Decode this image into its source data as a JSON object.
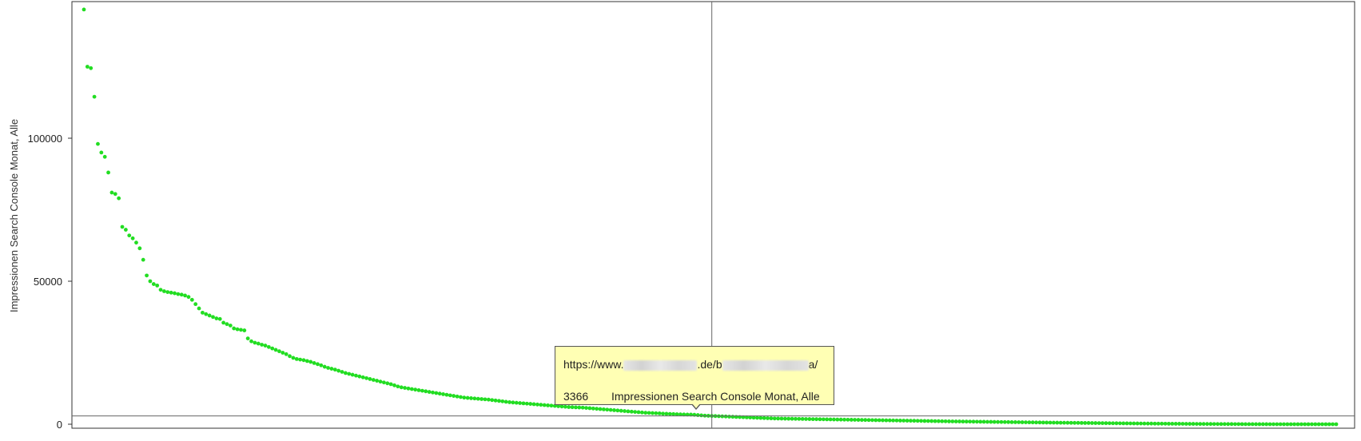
{
  "chart_data": {
    "type": "scatter",
    "title": "",
    "xlabel": "",
    "ylabel": "Impressionen Search Console Monat, Alle",
    "ylim": [
      0,
      145000
    ],
    "yticks": [
      0,
      50000,
      100000
    ],
    "ytick_labels": [
      "0",
      "50000",
      "100000"
    ],
    "grid": false,
    "legend": "none",
    "point_color": "#22dd22",
    "crosshair_color": "#666666",
    "n_points": 380,
    "series": [
      {
        "values": [
          145000,
          125000,
          124500,
          114500,
          98000,
          95000,
          93500,
          88000,
          81000,
          80500,
          79000,
          69000,
          68000,
          66000,
          65000,
          63500,
          61500,
          57500,
          52000,
          50000,
          49000,
          48500,
          47000,
          46500,
          46200,
          46000,
          45800,
          45500,
          45300,
          45000,
          44500,
          43500,
          42000,
          40500,
          39000,
          38500,
          38000,
          37500,
          37000,
          36800,
          35500,
          35000,
          34500,
          33500,
          33200,
          33000,
          32800,
          30000,
          29000,
          28500,
          28200,
          27800,
          27500,
          27000,
          26500,
          26000,
          25500,
          25000,
          24500,
          23800,
          23200,
          22800,
          22600,
          22400,
          22100,
          21800,
          21400,
          21000,
          20600,
          20100,
          19700,
          19400,
          19100,
          18700,
          18300,
          17900,
          17600,
          17300,
          17000,
          16700,
          16400,
          16100,
          15800,
          15500,
          15200,
          14900,
          14600,
          14300,
          14000,
          13600,
          13200,
          12900,
          12700,
          12500,
          12300,
          12100,
          11900,
          11700,
          11500,
          11300,
          11100,
          10900,
          10700,
          10500,
          10300,
          10100,
          9900,
          9700,
          9500,
          9300,
          9200,
          9100,
          9000,
          8900,
          8800,
          8700,
          8600,
          8450,
          8300,
          8150,
          8000,
          7850,
          7700,
          7600,
          7500,
          7400,
          7300,
          7200,
          7100,
          7000,
          6900,
          6800,
          6700,
          6600,
          6500,
          6400,
          6300,
          6200,
          6100,
          6000,
          5950,
          5900,
          5850,
          5800,
          5700,
          5600,
          5500,
          5400,
          5300,
          5200,
          5100,
          5000,
          4900,
          4800,
          4700,
          4600,
          4500,
          4400,
          4300,
          4200,
          4100,
          4000,
          3950,
          3900,
          3850,
          3800,
          3700,
          3650,
          3600,
          3550,
          3500,
          3450,
          3400,
          3380,
          3366,
          3300,
          3200,
          3100,
          3000,
          2950,
          2900,
          2850,
          2800,
          2750,
          2700,
          2650,
          2600,
          2550,
          2500,
          2450,
          2400,
          2350,
          2300,
          2250,
          2200,
          2150,
          2100,
          2050,
          2000,
          1980,
          1960,
          1940,
          1920,
          1900,
          1880,
          1860,
          1840,
          1820,
          1800,
          1780,
          1760,
          1740,
          1720,
          1700,
          1680,
          1660,
          1640,
          1620,
          1600,
          1580,
          1560,
          1540,
          1520,
          1500,
          1480,
          1460,
          1440,
          1420,
          1400,
          1380,
          1360,
          1340,
          1320,
          1300,
          1280,
          1260,
          1240,
          1220,
          1200,
          1180,
          1160,
          1140,
          1120,
          1100,
          1080,
          1060,
          1040,
          1020,
          1000,
          985,
          970,
          955,
          940,
          925,
          910,
          895,
          880,
          865,
          850,
          835,
          820,
          805,
          790,
          775,
          760,
          745,
          730,
          715,
          700,
          685,
          670,
          655,
          640,
          625,
          610,
          595,
          580,
          565,
          550,
          538,
          526,
          514,
          502,
          490,
          478,
          466,
          454,
          442,
          430,
          418,
          406,
          394,
          382,
          370,
          358,
          346,
          334,
          322,
          310,
          298,
          286,
          274,
          262,
          250,
          240,
          230,
          220,
          210,
          200,
          192,
          184,
          176,
          168,
          160,
          152,
          144,
          136,
          128,
          120,
          113,
          106,
          99,
          92,
          85,
          79,
          73,
          67,
          61,
          55,
          50,
          45,
          40,
          36,
          32,
          28,
          24,
          20,
          17,
          14,
          11,
          8,
          6,
          4,
          2,
          1,
          0,
          0,
          0,
          0,
          0,
          0,
          0,
          0,
          0,
          0,
          0,
          0,
          0,
          0,
          0
        ]
      }
    ],
    "highlight_index": 180,
    "tooltip": {
      "url_prefix": "https://www.",
      "url_domain_suffix": ".de/b",
      "url_end": "a/",
      "value": "3366",
      "label": "Impressionen Search Console Monat, Alle"
    }
  }
}
